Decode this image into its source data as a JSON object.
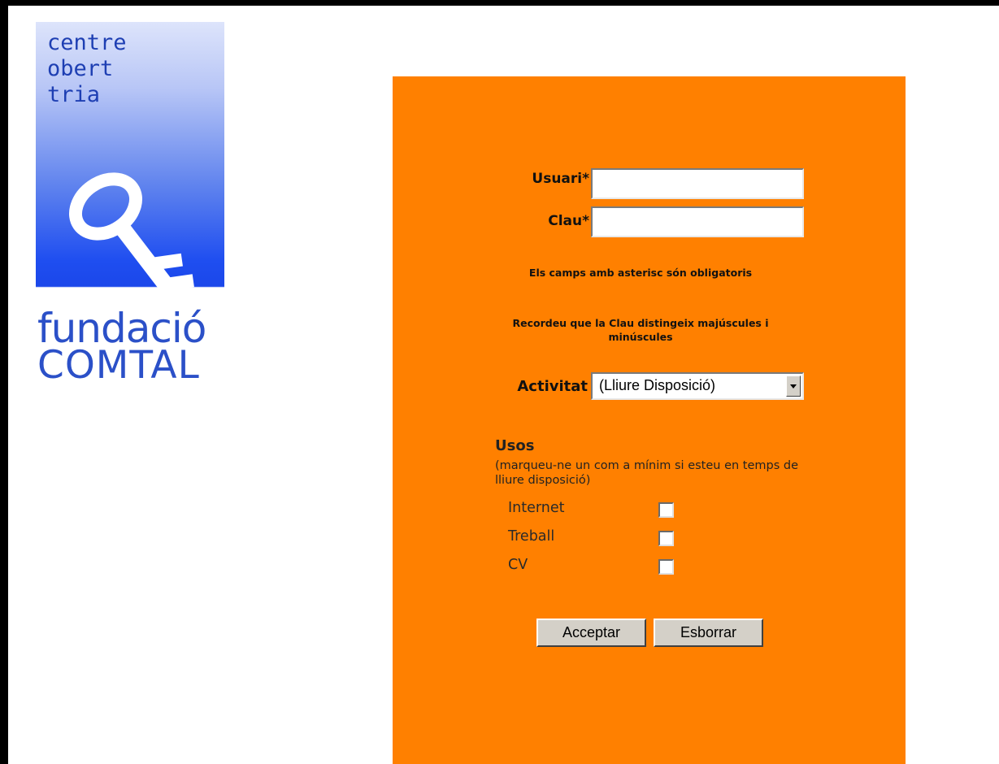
{
  "logo": {
    "line1": "centre",
    "line2": "obert",
    "line3": "tria",
    "brand1": "fundació",
    "brand2": "COMTAL",
    "key_color": "#ffffff",
    "gradient_colors": [
      "#dde4fb",
      "#1b47ea"
    ]
  },
  "form": {
    "background_color": "#ff8000",
    "user_label": "Usuari*",
    "user_value": "",
    "password_label": "Clau*",
    "password_value": "",
    "note_required": "Els camps amb asterisc són obligatoris",
    "note_case": "Recordeu que la Clau distingeix majúscules i minúscules",
    "activity_label": "Activitat",
    "activity_selected": "(Lliure Disposició)",
    "usos_title": "Usos",
    "usos_hint": "(marqueu-ne un com a mínim si esteu en temps de lliure disposició)",
    "usos_options": [
      {
        "label": "Internet",
        "checked": false
      },
      {
        "label": "Treball",
        "checked": false
      },
      {
        "label": "CV",
        "checked": false
      }
    ],
    "accept_button": "Acceptar",
    "reset_button": "Esborrar"
  }
}
